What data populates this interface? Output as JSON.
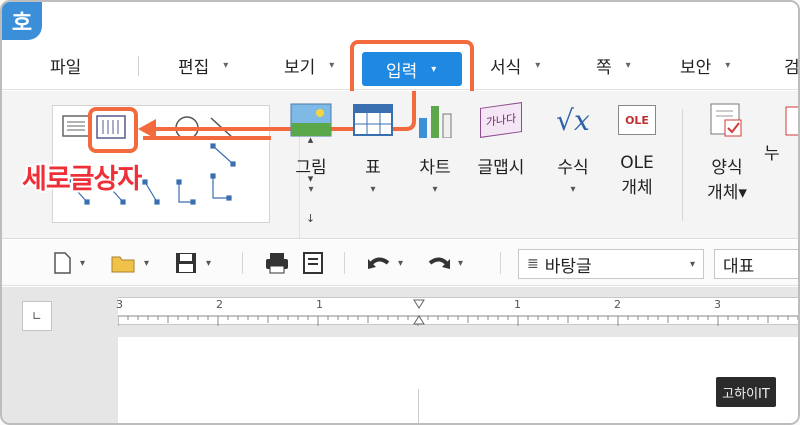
{
  "app": {
    "logo_glyph": "호"
  },
  "menu": {
    "items": [
      {
        "label": "파일",
        "has_caret": false
      },
      {
        "label": "편집",
        "has_caret": true
      },
      {
        "label": "보기",
        "has_caret": true
      },
      {
        "label": "입력",
        "has_caret": true,
        "active": true
      },
      {
        "label": "서식",
        "has_caret": true
      },
      {
        "label": "쪽",
        "has_caret": true
      },
      {
        "label": "보안",
        "has_caret": true
      },
      {
        "label": "검",
        "has_caret": false
      }
    ],
    "caret_glyph": "▾"
  },
  "ribbon": {
    "tools": [
      {
        "label": "그림",
        "icon": "picture-icon"
      },
      {
        "label": "표",
        "icon": "table-icon"
      },
      {
        "label": "차트",
        "icon": "chart-icon"
      },
      {
        "label": "글맵시",
        "icon": "wordart-icon",
        "icon_text": "가나다"
      },
      {
        "label": "수식",
        "icon": "formula-icon",
        "icon_text": "√x"
      },
      {
        "label": "OLE",
        "label2": "개체",
        "icon": "ole-icon",
        "icon_text": "OLE"
      },
      {
        "label": "양식",
        "label2": "개체▾",
        "icon": "form-icon"
      },
      {
        "label": "누",
        "icon": "partial-icon"
      }
    ],
    "dropdown_glyph": "▾"
  },
  "annotation": {
    "label": "세로글상자",
    "accent": "#ee2f37",
    "highlight": "#f26a3d"
  },
  "toolbar": {
    "paragraph_style": "바탕글",
    "font": "대표"
  },
  "ruler": {
    "ticks": [
      "3",
      "2",
      "1",
      "1",
      "2",
      "3"
    ]
  },
  "watermark": {
    "text": "고하이IT"
  },
  "colors": {
    "accent_blue": "#1f88e0",
    "app_blue": "#3a8fd8"
  }
}
